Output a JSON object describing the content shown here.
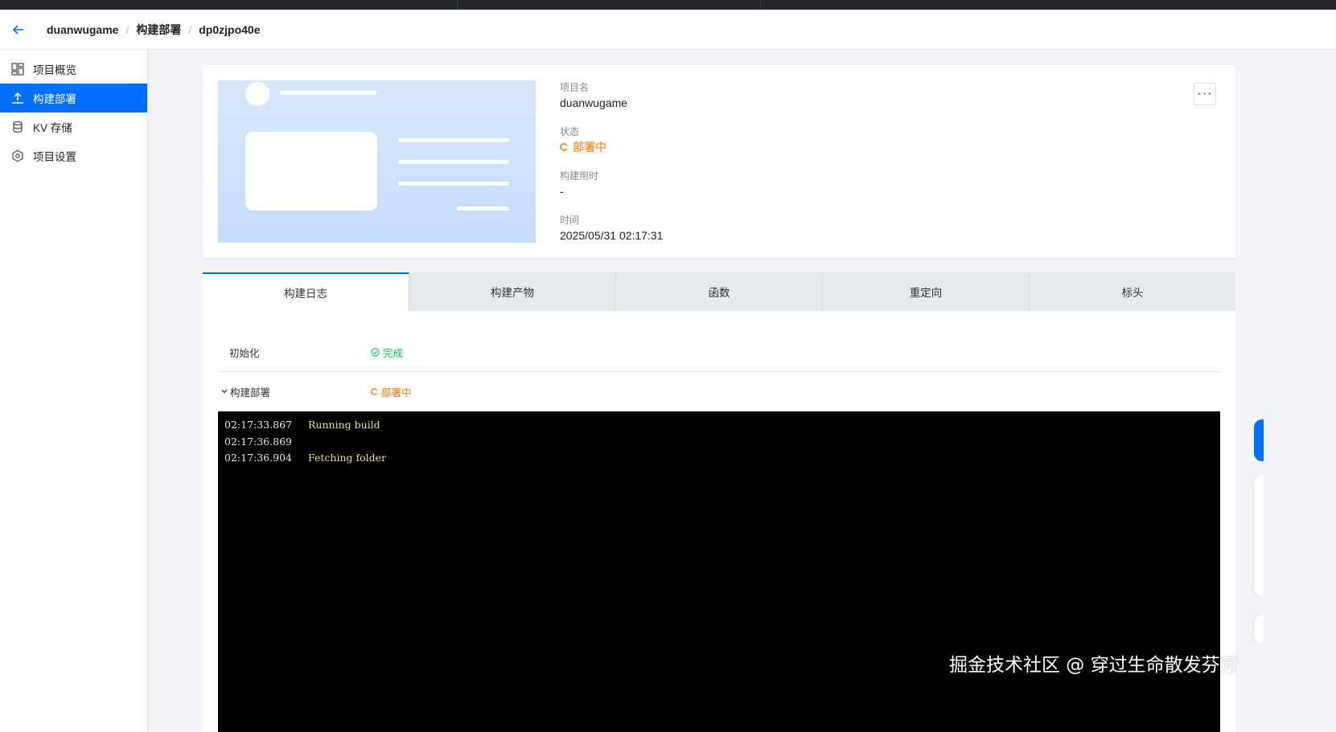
{
  "header": {
    "back_icon": "arrow-left-icon",
    "breadcrumbs": [
      "duanwugame",
      "构建部署",
      "dp0zjpo40e"
    ]
  },
  "sidebar": {
    "items": [
      {
        "label": "项目概览",
        "icon": "dashboard-icon",
        "active": false
      },
      {
        "label": "构建部署",
        "icon": "upload-icon",
        "active": true
      },
      {
        "label": "KV 存储",
        "icon": "database-icon",
        "active": false
      },
      {
        "label": "项目设置",
        "icon": "gear-icon",
        "active": false
      }
    ]
  },
  "project": {
    "name_label": "项目名",
    "name": "duanwugame",
    "status_label": "状态",
    "status": "部署中",
    "build_time_label": "构建用时",
    "build_time": "-",
    "time_label": "时间",
    "time": "2025/05/31 02:17:31",
    "more_label": "···"
  },
  "tabs": [
    {
      "label": "构建日志",
      "active": true
    },
    {
      "label": "构建产物",
      "active": false
    },
    {
      "label": "函数",
      "active": false
    },
    {
      "label": "重定向",
      "active": false
    },
    {
      "label": "标头",
      "active": false
    }
  ],
  "stages": [
    {
      "name": "初始化",
      "status": "完成",
      "status_type": "success"
    },
    {
      "name": "构建部署",
      "status": "部署中",
      "status_type": "pending"
    }
  ],
  "log": [
    {
      "time": "02:17:33.867",
      "message": "Running build"
    },
    {
      "time": "02:17:36.869",
      "message": ""
    },
    {
      "time": "02:17:36.904",
      "message": "Fetching folder"
    }
  ],
  "watermark": "掘金技术社区 @ 穿过生命散发芬芳",
  "colors": {
    "accent": "#006eff",
    "pending": "#ff7200",
    "success": "#0abf5b",
    "terminal_bg": "#000000"
  }
}
